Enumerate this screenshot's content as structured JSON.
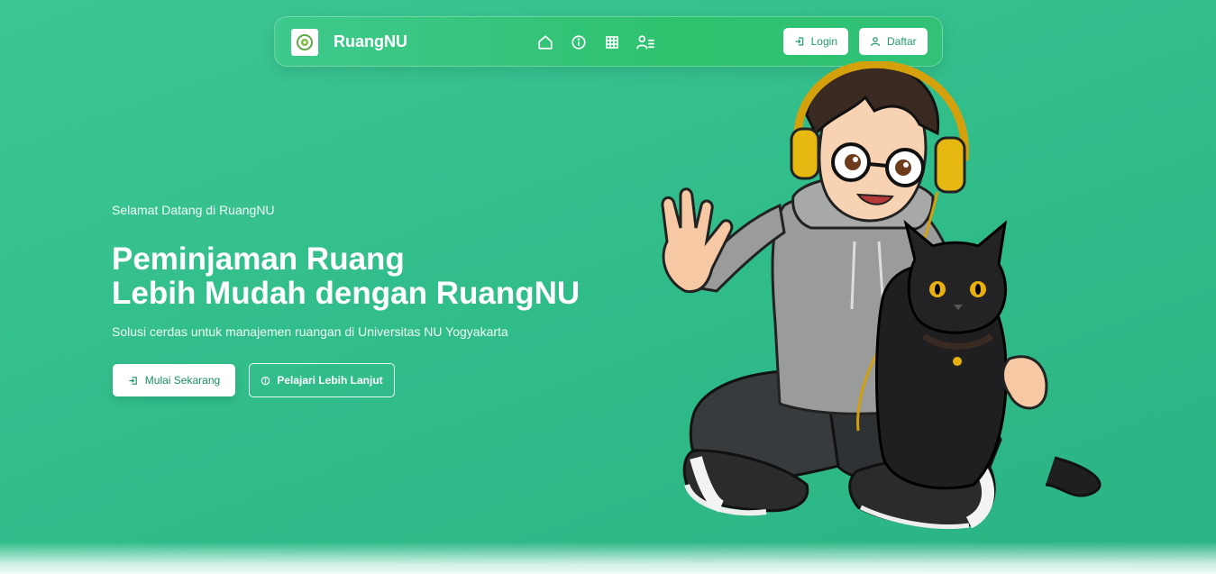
{
  "navbar": {
    "brand": "RuangNU",
    "icons": [
      "home-icon",
      "info-icon",
      "grid-icon",
      "user-list-icon"
    ],
    "login_label": "Login",
    "register_label": "Daftar"
  },
  "hero": {
    "welcome": "Selamat Datang di RuangNU",
    "headline_line1": "Peminjaman Ruang",
    "headline_line2": "Lebih Mudah dengan RuangNU",
    "subtitle": "Solusi cerdas untuk manajemen ruangan di Universitas NU Yogyakarta",
    "primary_button": "Mulai Sekarang",
    "secondary_button": "Pelajari Lebih Lanjut"
  },
  "colors": {
    "background": "#33c08c",
    "navbar": "#2ec26e",
    "accent_text": "#1e9e6a"
  }
}
